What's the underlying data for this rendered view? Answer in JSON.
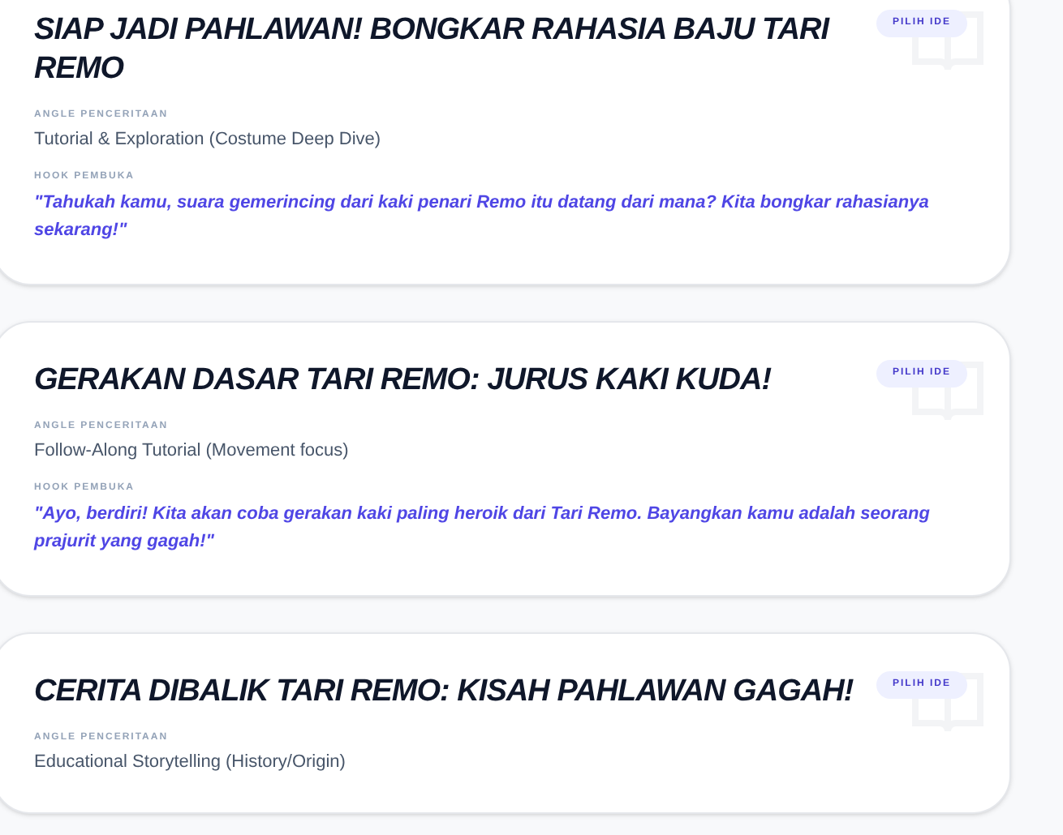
{
  "ideas": [
    {
      "title": "SIAP JADI PAHLAWAN! BONGKAR RAHASIA BAJU TARI REMO",
      "button": "PILIH IDE",
      "angle_label": "ANGLE PENCERITAAN",
      "angle": "Tutorial & Exploration (Costume Deep Dive)",
      "hook_label": "HOOK PEMBUKA",
      "hook": "\"Tahukah kamu, suara gemerincing dari kaki penari Remo itu datang dari mana? Kita bongkar rahasianya sekarang!\""
    },
    {
      "title": "GERAKAN DASAR TARI REMO: JURUS KAKI KUDA!",
      "button": "PILIH IDE",
      "angle_label": "ANGLE PENCERITAAN",
      "angle": "Follow-Along Tutorial (Movement focus)",
      "hook_label": "HOOK PEMBUKA",
      "hook": "\"Ayo, berdiri! Kita akan coba gerakan kaki paling heroik dari Tari Remo. Bayangkan kamu adalah seorang prajurit yang gagah!\""
    },
    {
      "title": "CERITA DIBALIK TARI REMO: KISAH PAHLAWAN GAGAH!",
      "button": "PILIH IDE",
      "angle_label": "ANGLE PENCERITAAN",
      "angle": "Educational Storytelling (History/Origin)"
    }
  ]
}
